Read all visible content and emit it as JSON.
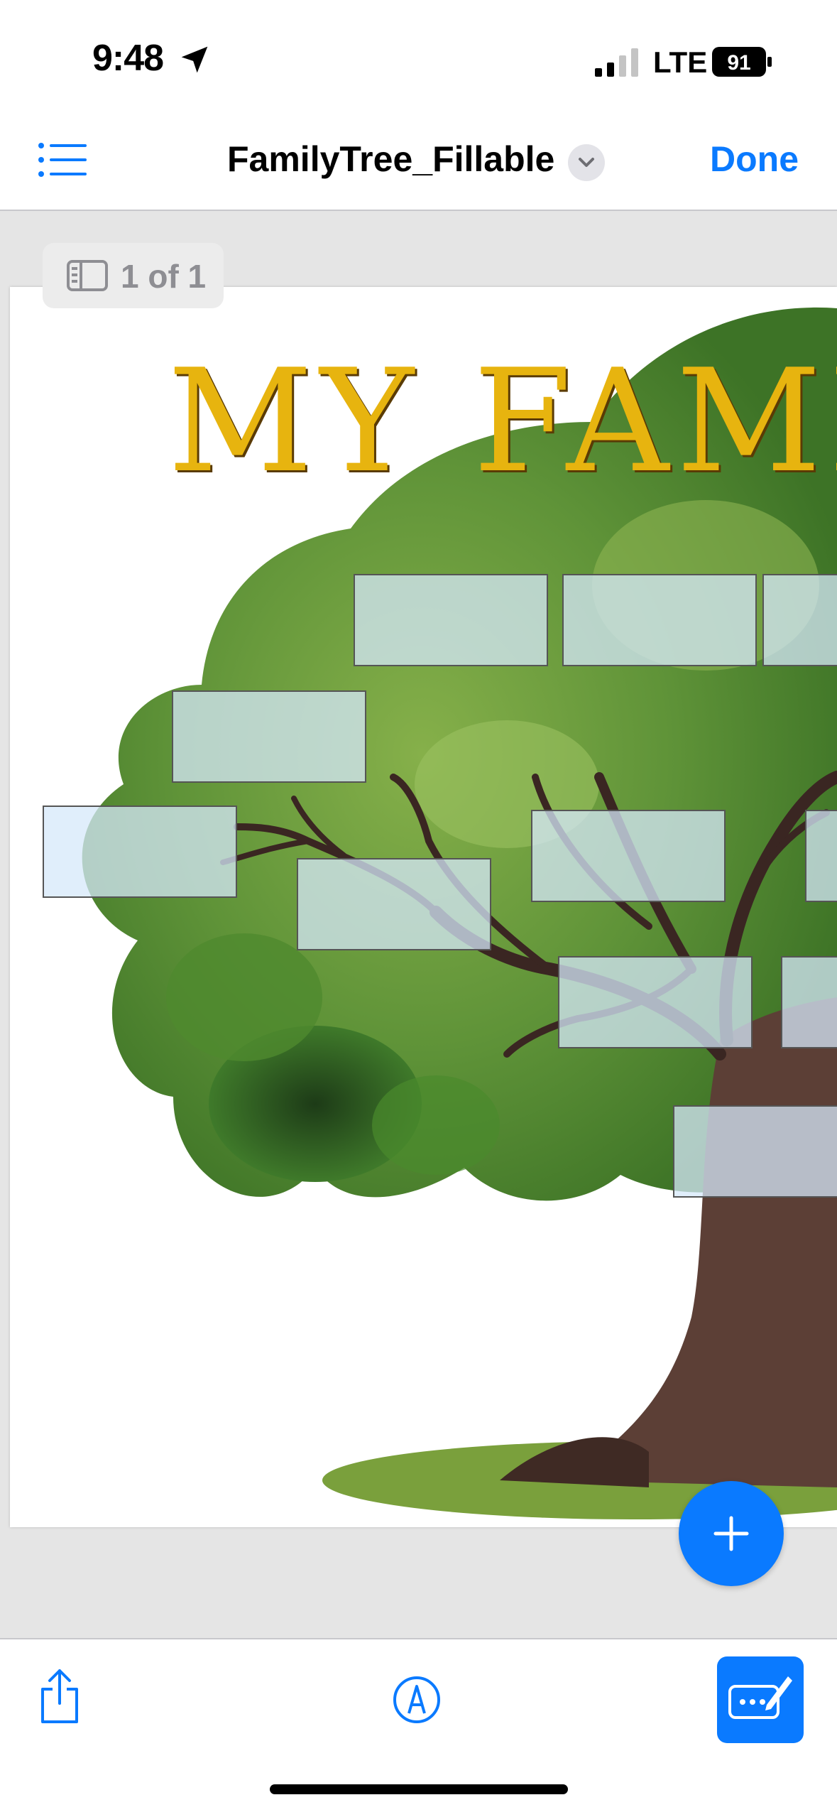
{
  "status_bar": {
    "time": "9:48",
    "network": "LTE",
    "battery": "91"
  },
  "nav": {
    "title": "FamilyTree_Fillable",
    "done_label": "Done"
  },
  "page_indicator": "1 of 1",
  "document": {
    "heading": "MY FAMI"
  },
  "icons": {
    "sidebar": "list-icon",
    "title_menu": "chevron-down-icon",
    "add": "plus-icon",
    "share": "share-icon",
    "markup": "pen-circle-icon",
    "form_fill": "keyboard-pen-icon"
  },
  "colors": {
    "accent": "#0a7aff",
    "title_gold": "#e7b40f",
    "field_fill": "#d6e8fa"
  }
}
